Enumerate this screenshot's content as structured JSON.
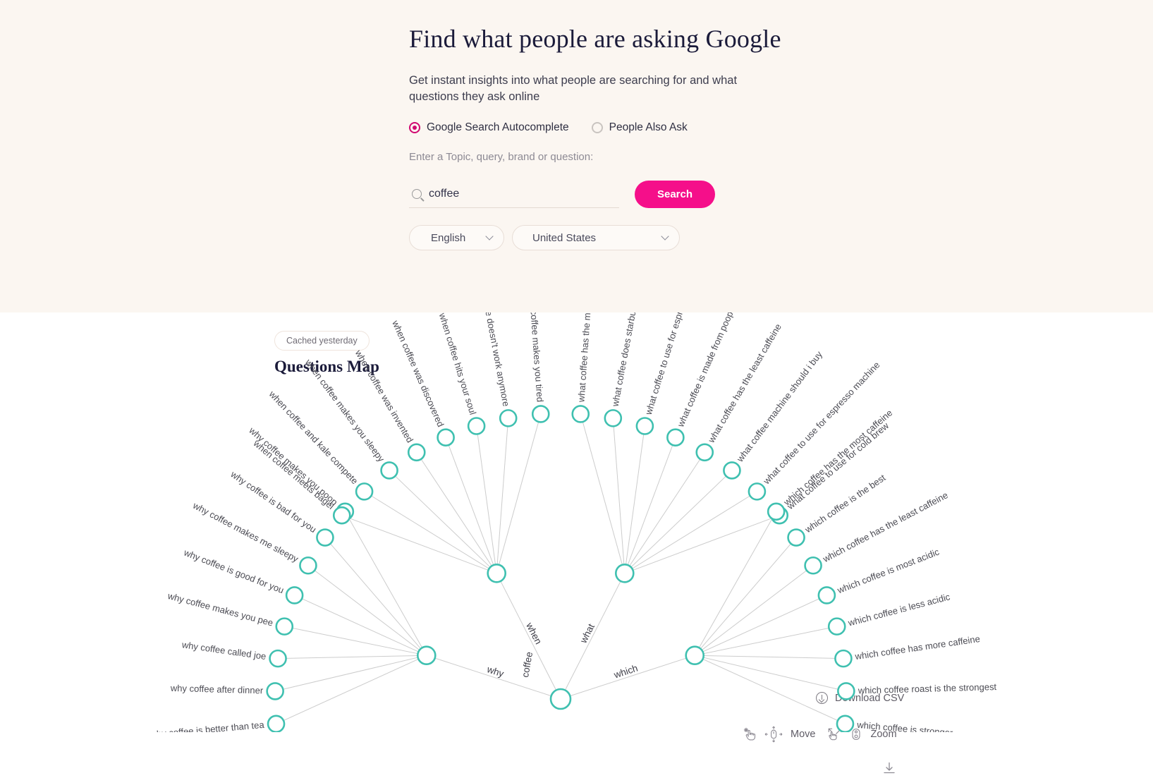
{
  "hero": {
    "title": "Find what people are asking Google",
    "subtitle": "Get instant insights into what people are searching for and what questions they ask online",
    "modes": [
      {
        "label": "Google Search Autocomplete",
        "selected": true
      },
      {
        "label": "People Also Ask",
        "selected": false
      }
    ],
    "field_label": "Enter a Topic, query, brand or question:",
    "search": {
      "value": "coffee",
      "placeholder": "Enter a Topic, query, brand or question",
      "button_label": "Search",
      "icon": "search-icon"
    },
    "language_select": {
      "value": "English",
      "icon": "chevron-down-icon"
    },
    "country_select": {
      "value": "United States",
      "icon": "chevron-down-icon"
    },
    "accent_color": "#f50f8a",
    "background_color": "#fbf6f1"
  },
  "results": {
    "cached_badge": "Cached yesterday",
    "map_title": "Questions Map",
    "download_csv": {
      "label": "Download CSV",
      "icon": "download-circle-icon"
    },
    "controls": {
      "move_label": "Move",
      "zoom_label": "Zoom",
      "move_icons": [
        "hand-drag-icon",
        "mouse-pan-icon"
      ],
      "zoom_icons": [
        "pinch-zoom-icon",
        "mouse-scroll-icon"
      ]
    },
    "map_download_icon": "download-arrow-icon",
    "node_color": "#3fc0b0",
    "edge_color": "#cccccc"
  },
  "chart_data": {
    "type": "tree",
    "title": "Questions Map",
    "root": "coffee",
    "branches": [
      {
        "label": "why",
        "children": [
          "why coffee is better than tea",
          "why coffee after dinner",
          "why coffee called joe",
          "why coffee makes you pee",
          "why coffee is good for you",
          "why coffee makes me sleepy",
          "why coffee is bad for you",
          "why coffee makes you poop"
        ]
      },
      {
        "label": "when",
        "children": [
          "when coffee meets bagel",
          "when coffee and kale compete",
          "when coffee makes you sleepy",
          "when coffee was invented",
          "when coffee was discovered",
          "when coffee hits your soul",
          "when coffee doesn't work anymore",
          "when coffee makes you tired"
        ]
      },
      {
        "label": "what",
        "children": [
          "what coffee has the most caff",
          "what coffee does starbucks us",
          "what coffee to use for espresso",
          "what coffee is made from poop",
          "what coffee has the least caffeine",
          "what coffee machine should i buy",
          "what coffee to use for espresso machine",
          "what coffee to use for cold brew"
        ]
      },
      {
        "label": "which",
        "children": [
          "which coffee has the most caffeine",
          "which coffee is the best",
          "which coffee has the least caffeine",
          "which coffee is most acidic",
          "which coffee is less acidic",
          "which coffee has more caffeine",
          "which coffee roast is the strongest",
          "which coffee is stronger"
        ]
      }
    ]
  }
}
